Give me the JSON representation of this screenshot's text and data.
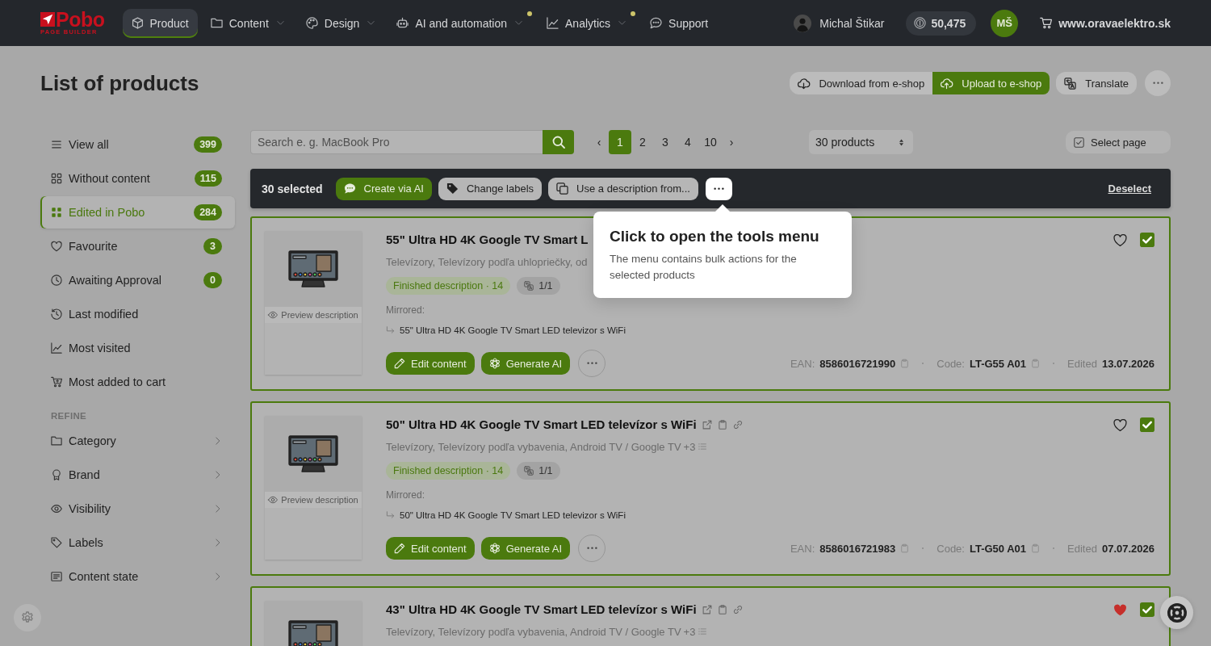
{
  "nav": {
    "logo": {
      "name": "Pobo",
      "tagline": "PAGE BUILDER"
    },
    "items": [
      {
        "label": "Product",
        "selected": true,
        "dropdown": false,
        "notification": false
      },
      {
        "label": "Content",
        "selected": false,
        "dropdown": true,
        "notification": false
      },
      {
        "label": "Design",
        "selected": false,
        "dropdown": true,
        "notification": false
      },
      {
        "label": "AI and automation",
        "selected": false,
        "dropdown": true,
        "notification": true
      },
      {
        "label": "Analytics",
        "selected": false,
        "dropdown": true,
        "notification": true
      },
      {
        "label": "Support",
        "selected": false,
        "dropdown": false,
        "notification": false
      }
    ],
    "user": {
      "name": "Michal Štikar",
      "credits": "50,475",
      "initials": "MŠ"
    },
    "shop": "www.oravaelektro.sk"
  },
  "header": {
    "title": "List of products",
    "sync": [
      {
        "label": "Download from e-shop",
        "kind": "secondary"
      },
      {
        "label": "Upload to e-shop",
        "kind": "primary"
      }
    ],
    "actions": [
      {
        "label": "Translate",
        "kind": "secondary"
      }
    ]
  },
  "sidebar": {
    "views": [
      {
        "label": "View all",
        "count": "399",
        "selected": false
      },
      {
        "label": "Without content",
        "count": "115",
        "selected": false
      },
      {
        "label": "Edited in Pobo",
        "count": "284",
        "selected": true
      },
      {
        "label": "Favourite",
        "count": "3",
        "selected": false
      },
      {
        "label": "Awaiting Approval",
        "count": "0",
        "selected": false
      },
      {
        "label": "Last modified",
        "selected": false
      },
      {
        "label": "Most visited",
        "selected": false
      },
      {
        "label": "Most added to cart",
        "selected": false
      }
    ],
    "refine": {
      "heading": "REFINE",
      "items": [
        {
          "label": "Category"
        },
        {
          "label": "Brand"
        },
        {
          "label": "Visibility"
        },
        {
          "label": "Labels"
        },
        {
          "label": "Content state"
        }
      ]
    }
  },
  "toolbar": {
    "search": {
      "placeholder": "Search e. g. MacBook Pro"
    },
    "pagination": {
      "prev": "‹",
      "next": "›",
      "pages": [
        {
          "label": "1",
          "selected": true
        },
        {
          "label": "2",
          "selected": false
        },
        {
          "label": "3",
          "selected": false
        },
        {
          "label": "4",
          "selected": false
        },
        {
          "label": "10",
          "selected": false
        }
      ]
    },
    "page_size": "30 products",
    "select_page": "Select page"
  },
  "bulk_bar": {
    "count": "30 selected",
    "actions": [
      {
        "label": "Create via AI",
        "kind": "primary"
      },
      {
        "label": "Change labels",
        "kind": "secondary"
      },
      {
        "label": "Use a description from...",
        "kind": "secondary"
      }
    ],
    "deselect": "Deselect"
  },
  "tour_tip": {
    "title": "Click to open the tools menu",
    "text": "The menu contains bulk actions for the selected products"
  },
  "products": [
    {
      "title": "55\" Ultra HD 4K Google TV Smart L",
      "link_icons": false,
      "category": "Televízory, Televízory podľa uhlopriečky, od",
      "status": "Finished description · 14",
      "translations": "1/1",
      "preview": "Preview description",
      "mirrored_label": "Mirrored:",
      "mirrored": "55\" Ultra HD 4K Google TV Smart LED televizor s WiFi",
      "actions": [
        "Edit content",
        "Generate AI"
      ],
      "ean_label": "EAN:",
      "ean": "8586016721990",
      "code_label": "Code:",
      "code": "LT-G55 A01",
      "edited_label": "Edited",
      "edited": "13.07.2026",
      "favourite": false,
      "selected": true
    },
    {
      "title": "50\" Ultra HD 4K Google TV Smart LED televízor s WiFi",
      "link_icons": true,
      "category": "Televízory, Televízory podľa vybavenia, Android TV / Google TV",
      "more_categories": "+3",
      "status": "Finished description · 14",
      "translations": "1/1",
      "preview": "Preview description",
      "mirrored_label": "Mirrored:",
      "mirrored": "50\" Ultra HD 4K Google TV Smart LED televizor s WiFi",
      "actions": [
        "Edit content",
        "Generate AI"
      ],
      "ean_label": "EAN:",
      "ean": "8586016721983",
      "code_label": "Code:",
      "code": "LT-G50 A01",
      "edited_label": "Edited",
      "edited": "07.07.2026",
      "favourite": false,
      "selected": true
    },
    {
      "title": "43\" Ultra HD 4K Google TV Smart LED televízor s WiFi",
      "link_icons": true,
      "category": "Televízory, Televízory podľa vybavenia, Android TV / Google TV",
      "more_categories": "+3",
      "favourite": true,
      "selected": true
    }
  ]
}
